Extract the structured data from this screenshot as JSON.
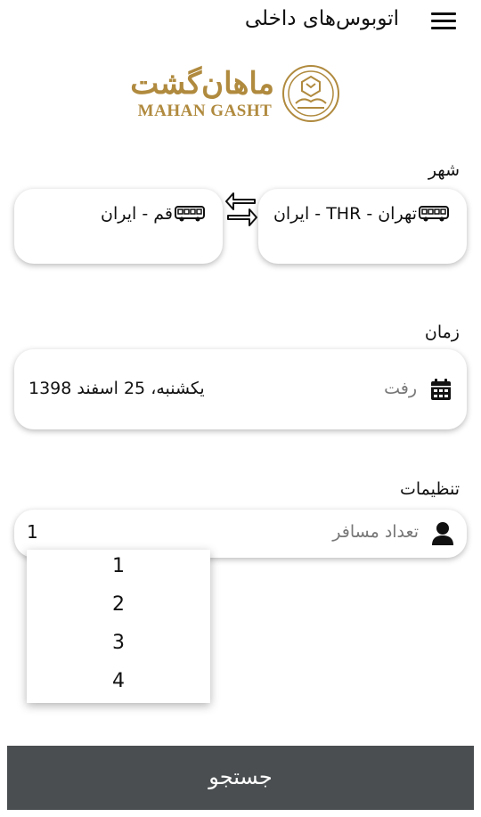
{
  "header": {
    "title": "اتوبوس‌های داخلی",
    "menu_icon": "hamburger-menu-icon"
  },
  "logo": {
    "text_fa": "ماهان‌گشت",
    "text_en": "MAHAN GASHT",
    "brand_color": "#b08a3e"
  },
  "city_section": {
    "label": "شهر",
    "origin": "تهران - THR - ایران",
    "destination": "قم - ایران",
    "city_icon": "bus-icon",
    "swap_icon": "swap-arrows-icon"
  },
  "time_section": {
    "label": "زمان",
    "date_hint": "رفت",
    "date_value": "یکشنبه، 25 اسفند 1398",
    "date_icon": "calendar-icon"
  },
  "settings_section": {
    "label": "تنظیمات",
    "passenger_hint": "تعداد مسافر",
    "passenger_value": "1",
    "passenger_icon": "person-icon",
    "options": [
      "1",
      "2",
      "3",
      "4"
    ]
  },
  "search_button": {
    "label": "جستجو",
    "color": "#4a4e50"
  }
}
